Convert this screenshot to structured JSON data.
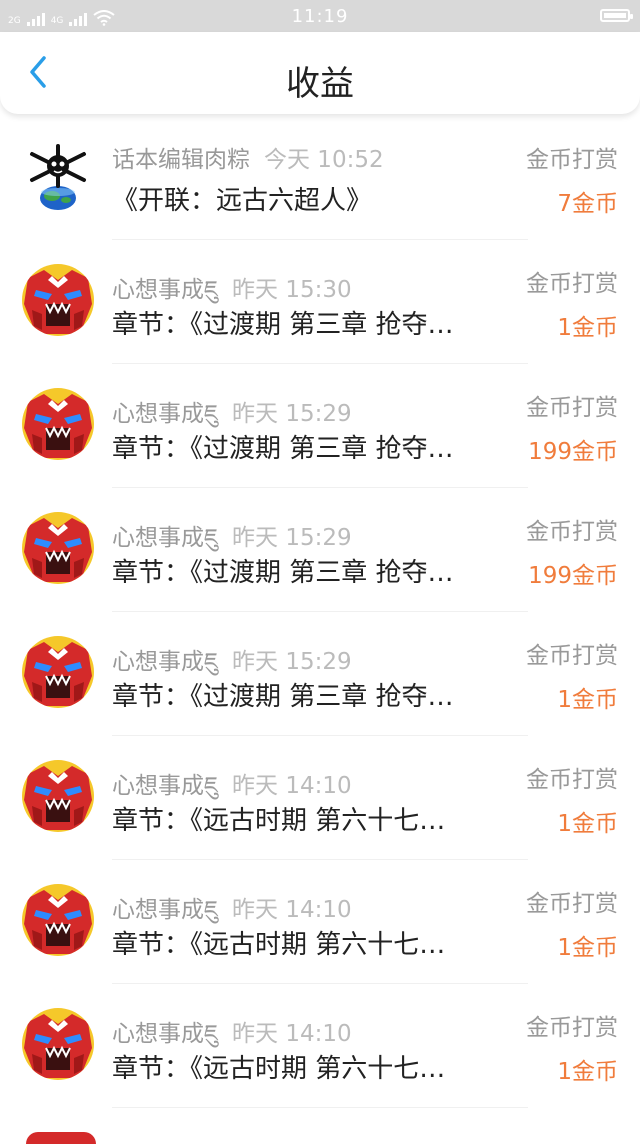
{
  "status_bar": {
    "sim1": "2G",
    "sim2": "4G",
    "time": "11:19"
  },
  "header": {
    "title": "收益",
    "back_icon": "chevron-left-icon",
    "accent_color": "#2a9ee8"
  },
  "items": [
    {
      "name": "话本编辑肉粽",
      "time": "今天 10:52",
      "message": "《开联：远古六超人》",
      "type": "金币打赏",
      "amount": "7金币",
      "avatar": "skull-globe-avatar"
    },
    {
      "name": "心想事成ཇུ",
      "time": "昨天 15:30",
      "message": "章节：《过渡期 第三章 抢夺…",
      "type": "金币打赏",
      "amount": "1金币",
      "avatar": "red-mask-avatar"
    },
    {
      "name": "心想事成ཇུ",
      "time": "昨天 15:29",
      "message": "章节：《过渡期 第三章 抢夺…",
      "type": "金币打赏",
      "amount": "199金币",
      "avatar": "red-mask-avatar"
    },
    {
      "name": "心想事成ཇུ",
      "time": "昨天 15:29",
      "message": "章节：《过渡期 第三章 抢夺…",
      "type": "金币打赏",
      "amount": "199金币",
      "avatar": "red-mask-avatar"
    },
    {
      "name": "心想事成ཇུ",
      "time": "昨天 15:29",
      "message": "章节：《过渡期 第三章 抢夺…",
      "type": "金币打赏",
      "amount": "1金币",
      "avatar": "red-mask-avatar"
    },
    {
      "name": "心想事成ཇུ",
      "time": "昨天 14:10",
      "message": "章节：《远古时期 第六十七…",
      "type": "金币打赏",
      "amount": "1金币",
      "avatar": "red-mask-avatar"
    },
    {
      "name": "心想事成ཇུ",
      "time": "昨天 14:10",
      "message": "章节：《远古时期 第六十七…",
      "type": "金币打赏",
      "amount": "1金币",
      "avatar": "red-mask-avatar"
    },
    {
      "name": "心想事成ཇུ",
      "time": "昨天 14:10",
      "message": "章节：《远古时期 第六十七…",
      "type": "金币打赏",
      "amount": "1金币",
      "avatar": "red-mask-avatar"
    }
  ]
}
